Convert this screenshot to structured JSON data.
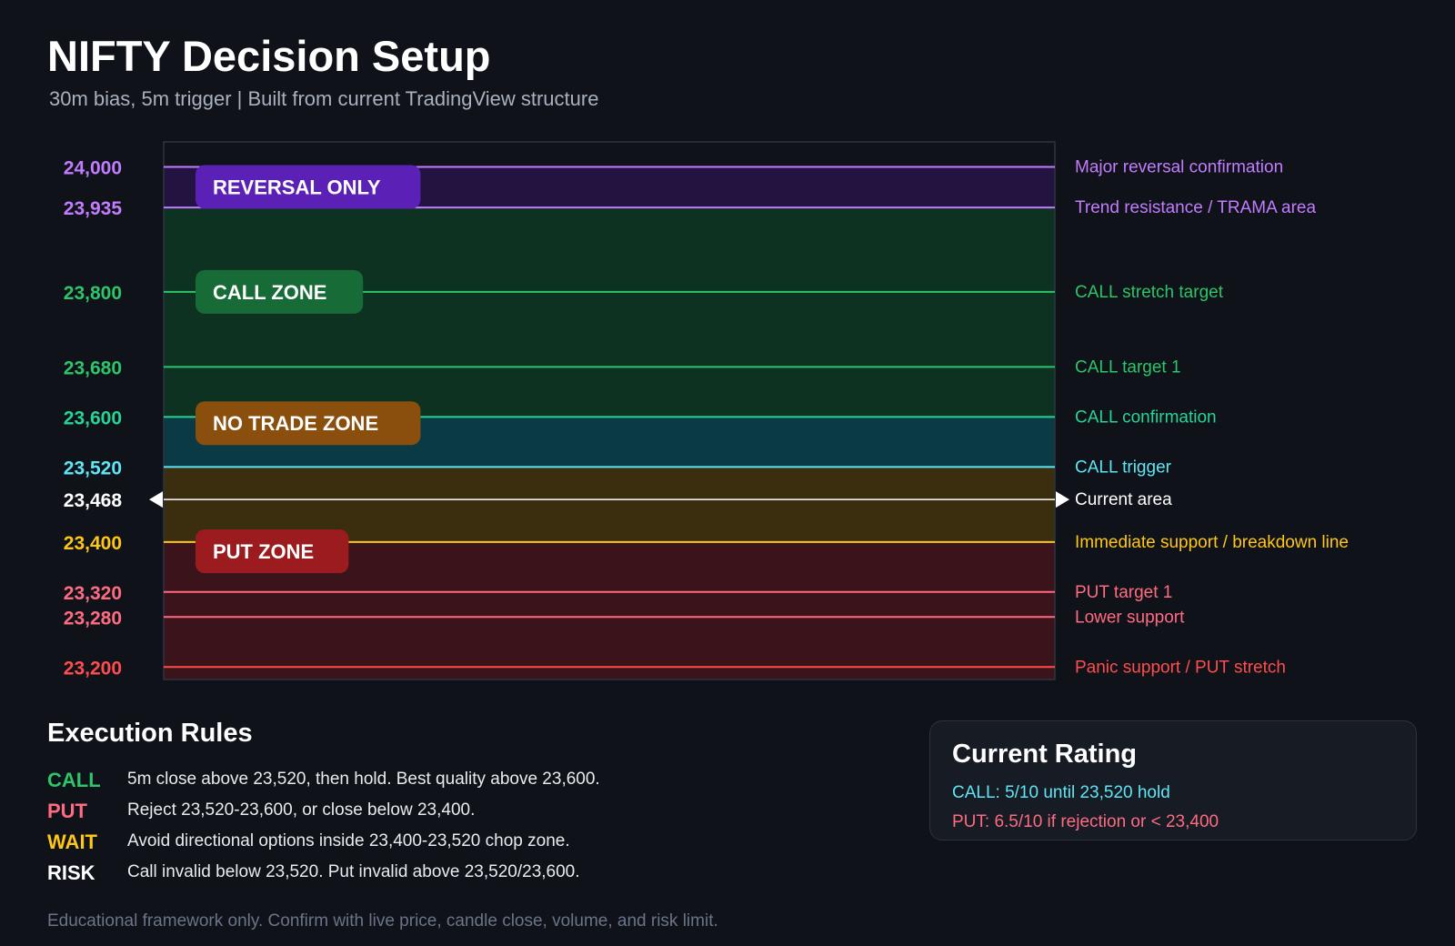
{
  "header": {
    "title": "NIFTY Decision Setup",
    "subtitle": "30m bias, 5m trigger | Built from current TradingView structure"
  },
  "chart_data": {
    "type": "horizontal-levels",
    "ylim": [
      23180,
      24040
    ],
    "levels": [
      {
        "value": 24000,
        "label": "24,000",
        "note": "Major reversal confirmation",
        "color": "#c27cff"
      },
      {
        "value": 23935,
        "label": "23,935",
        "note": "Trend resistance / TRAMA area",
        "color": "#c27cff"
      },
      {
        "value": 23800,
        "label": "23,800",
        "note": "CALL stretch target",
        "color": "#2ec46a"
      },
      {
        "value": 23680,
        "label": "23,680",
        "note": "CALL target 1",
        "color": "#2ec46a"
      },
      {
        "value": 23600,
        "label": "23,600",
        "note": "CALL confirmation",
        "color": "#27d496"
      },
      {
        "value": 23520,
        "label": "23,520",
        "note": "CALL trigger",
        "color": "#5ee6f5"
      },
      {
        "value": 23468,
        "label": "23,468",
        "note": "Current area",
        "color": "#ffffff",
        "current": true
      },
      {
        "value": 23400,
        "label": "23,400",
        "note": "Immediate support / breakdown line",
        "color": "#ffc61a"
      },
      {
        "value": 23320,
        "label": "23,320",
        "note": "PUT target 1",
        "color": "#ff6b81"
      },
      {
        "value": 23280,
        "label": "23,280",
        "note": "Lower support",
        "color": "#ff6b81"
      },
      {
        "value": 23200,
        "label": "23,200",
        "note": "Panic support / PUT stretch",
        "color": "#ff4d4d"
      }
    ],
    "bands": [
      {
        "from": 23935,
        "to": 24000,
        "color": "#231340"
      },
      {
        "from": 23600,
        "to": 23935,
        "color": "#0d3222"
      },
      {
        "from": 23520,
        "to": 23600,
        "color": "#0a3a44"
      },
      {
        "from": 23400,
        "to": 23520,
        "color": "#3a2e0f"
      },
      {
        "from": 23180,
        "to": 23400,
        "color": "#3b141b"
      }
    ],
    "zones": [
      {
        "name": "REVERSAL ONLY",
        "value": 23968,
        "color": "#5b21b6"
      },
      {
        "name": "CALL ZONE",
        "value": 23800,
        "color": "#176b37"
      },
      {
        "name": "NO TRADE ZONE",
        "value": 23590,
        "color": "#8a4f0d"
      },
      {
        "name": "PUT ZONE",
        "value": 23385,
        "color": "#9b1b1f"
      }
    ]
  },
  "execution": {
    "title": "Execution Rules",
    "rules": [
      {
        "key": "CALL",
        "text": "5m close above 23,520, then hold. Best quality above 23,600.",
        "color": "#2ec46a"
      },
      {
        "key": "PUT",
        "text": "Reject 23,520-23,600, or close below 23,400.",
        "color": "#ff6b81"
      },
      {
        "key": "WAIT",
        "text": "Avoid directional options inside 23,400-23,520 chop zone.",
        "color": "#ffc61a"
      },
      {
        "key": "RISK",
        "text": "Call invalid below 23,520. Put invalid above 23,520/23,600.",
        "color": "#ffffff"
      }
    ]
  },
  "rating": {
    "title": "Current Rating",
    "call": "CALL: 5/10 until 23,520 hold",
    "put": "PUT: 6.5/10 if rejection or < 23,400"
  },
  "footer": "Educational framework only. Confirm with live price, candle close, volume, and risk limit."
}
